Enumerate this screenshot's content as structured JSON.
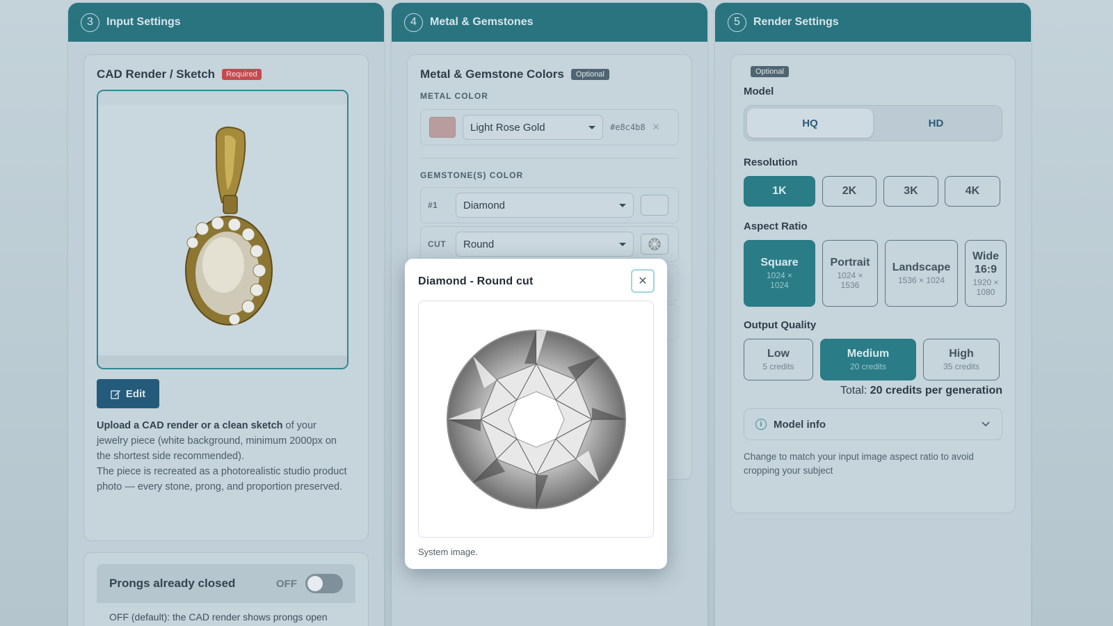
{
  "panels": {
    "input": {
      "step": "3",
      "title": "Input Settings",
      "card_title": "CAD Render / Sketch",
      "required_badge": "Required",
      "edit_label": "Edit",
      "desc_bold": "Upload a CAD render or a clean sketch",
      "desc_rest": " of your jewelry piece (white background, minimum 2000px on the shortest side recommended).",
      "desc_line2": "The piece is recreated as a photorealistic studio product photo — every stone, prong, and proportion preserved.",
      "prongs_label": "Prongs already closed",
      "prongs_state": "OFF",
      "prongs_on": false,
      "prongs_desc": "OFF (default): the CAD render shows prongs open"
    },
    "metal": {
      "step": "4",
      "title": "Metal & Gemstones",
      "card_title": "Metal & Gemstone Colors",
      "optional_badge": "Optional",
      "metal_label": "METAL COLOR",
      "metal_value": "Light Rose Gold",
      "metal_hex": "#e8c4b8",
      "metal_swatch": "#b89c9e",
      "gem_label": "GEMSTONE(S) COLOR",
      "gem_index": "#1",
      "gem_value": "Diamond",
      "cut_label": "CUT",
      "cut_value": "Round"
    },
    "render": {
      "step": "5",
      "title": "Render Settings",
      "optional_badge": "Optional",
      "model_label": "Model",
      "models": [
        "HQ",
        "HD"
      ],
      "model_selected": "HQ",
      "resolution_label": "Resolution",
      "resolutions": [
        "1K",
        "2K",
        "3K",
        "4K"
      ],
      "resolution_selected": "1K",
      "aspect_label": "Aspect Ratio",
      "aspects": [
        {
          "name": "Square",
          "dims": "1024 × 1024"
        },
        {
          "name": "Portrait",
          "dims": "1024 × 1536"
        },
        {
          "name": "Landscape",
          "dims": "1536 × 1024"
        },
        {
          "name": "Wide 16:9",
          "dims": "1920 × 1080"
        }
      ],
      "aspect_selected": "Square",
      "quality_label": "Output Quality",
      "qualities": [
        {
          "name": "Low",
          "credits": "5 credits"
        },
        {
          "name": "Medium",
          "credits": "20 credits"
        },
        {
          "name": "High",
          "credits": "35 credits"
        }
      ],
      "quality_selected": "Medium",
      "total_prefix": "Total:",
      "total_value": "20 credits per generation",
      "model_info_label": "Model info",
      "hint": "Change to match your input image aspect ratio to avoid cropping your subject"
    }
  },
  "modal": {
    "title": "Diamond - Round cut",
    "caption": "System image.",
    "close_icon": "close-icon"
  },
  "colors": {
    "accent": "#2a7c86",
    "header": "#2a7480",
    "required": "#c54a4f"
  }
}
